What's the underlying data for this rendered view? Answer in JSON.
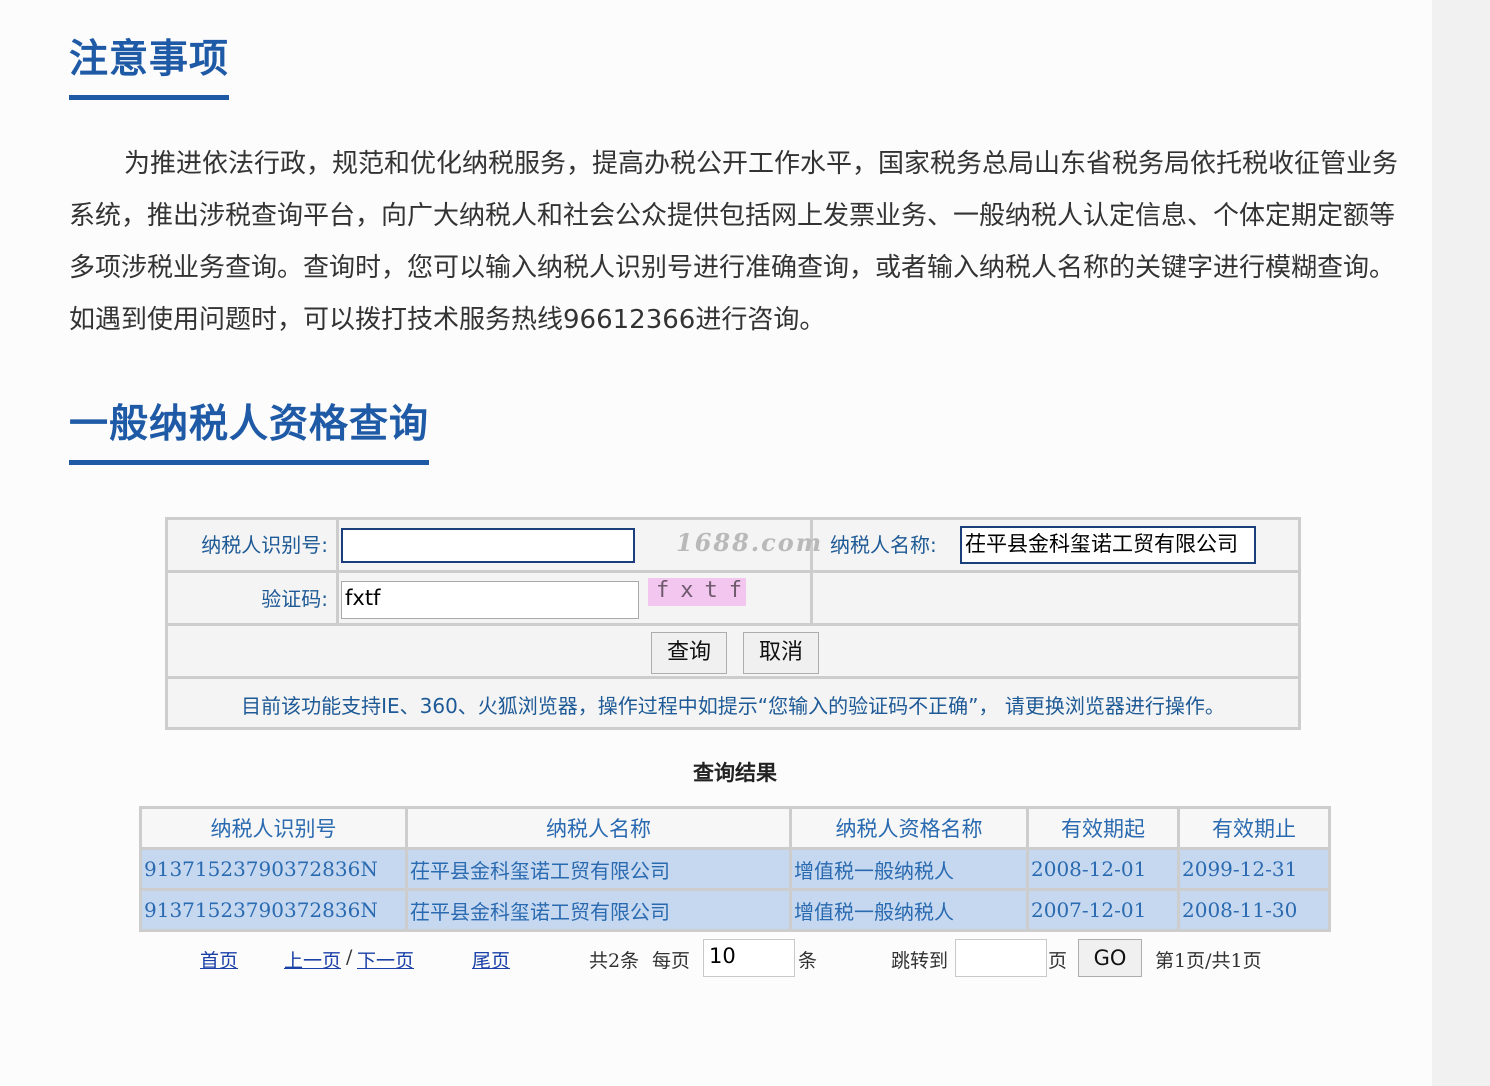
{
  "notice_section": {
    "title": "注意事项",
    "text": "为推进依法行政，规范和优化纳税服务，提高办税公开工作水平，国家税务总局山东省税务局依托税收征管业务系统，推出涉税查询平台，向广大纳税人和社会公众提供包括网上发票业务、一般纳税人认定信息、个体定期定额等多项涉税业务查询。查询时，您可以输入纳税人识别号进行准确查询，或者输入纳税人名称的关键字进行模糊查询。如遇到使用问题时，可以拨打技术服务热线96612366进行咨询。"
  },
  "query_section": {
    "title": "一般纳税人资格查询"
  },
  "form": {
    "taxpayer_id_label": "纳税人识别号:",
    "taxpayer_id_value": "",
    "watermark": "1688.com",
    "taxpayer_name_label": "纳税人名称:",
    "taxpayer_name_value": "茌平县金科玺诺工贸有限公司",
    "captcha_label": "验证码:",
    "captcha_value": "fxtf",
    "captcha_image_text": "fxtf",
    "submit_label": "查询",
    "cancel_label": "取消",
    "browser_notice": "目前该功能支持IE、360、火狐浏览器，操作过程中如提示“您输入的验证码不正确”， 请更换浏览器进行操作。"
  },
  "results": {
    "caption": "查询结果",
    "columns": [
      "纳税人识别号",
      "纳税人名称",
      "纳税人资格名称",
      "有效期起",
      "有效期止"
    ],
    "rows": [
      [
        "91371523790372836N",
        "茌平县金科玺诺工贸有限公司",
        "增值税一般纳税人",
        "2008-12-01",
        "2099-12-31"
      ],
      [
        "91371523790372836N",
        "茌平县金科玺诺工贸有限公司",
        "增值税一般纳税人",
        "2007-12-01",
        "2008-11-30"
      ]
    ]
  },
  "pager": {
    "first": "首页",
    "prev": "上一页",
    "sep": "/",
    "next": "下一页",
    "last": "尾页",
    "total": "共2条",
    "per_page_label": "每页",
    "per_page_value": "10",
    "per_page_unit": "条",
    "jump_label": "跳转到",
    "jump_value": "",
    "page_unit": "页",
    "go_label": "GO",
    "status": "第1页/共1页"
  }
}
